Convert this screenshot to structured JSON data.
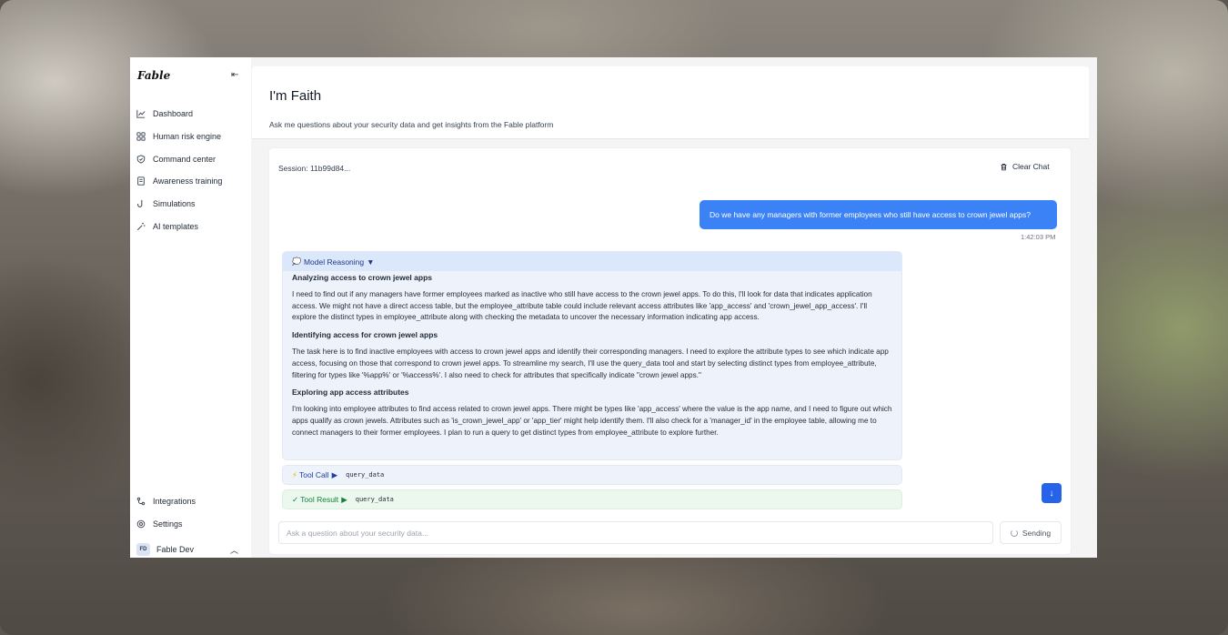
{
  "app": {
    "logo_text": "Fable"
  },
  "sidebar": {
    "items": [
      {
        "label": "Dashboard",
        "icon": "chart-line-icon"
      },
      {
        "label": "Human risk engine",
        "icon": "grid-icon"
      },
      {
        "label": "Command center",
        "icon": "shield-icon"
      },
      {
        "label": "Awareness training",
        "icon": "book-icon"
      },
      {
        "label": "Simulations",
        "icon": "hook-icon"
      },
      {
        "label": "AI templates",
        "icon": "wand-icon"
      }
    ],
    "bottom_items": [
      {
        "label": "Integrations",
        "icon": "integrations-icon"
      },
      {
        "label": "Settings",
        "icon": "settings-icon"
      }
    ],
    "user": {
      "initials": "FD",
      "name": "Fable Dev"
    }
  },
  "header": {
    "title": "I'm Faith",
    "subtitle": "Ask me questions about your security data and get insights from the Fable platform"
  },
  "chat": {
    "session_label": "Session: 11b99d84...",
    "clear_label": "Clear Chat",
    "user_message": "Do we have any managers with former employees who still have access to crown jewel apps?",
    "user_message_time": "1:42:03 PM",
    "reasoning": {
      "header_icon": "💭",
      "header_label": "Model Reasoning",
      "toggle": "▼",
      "sections": [
        {
          "heading": "Analyzing access to crown jewel apps",
          "text": "I need to find out if any managers have former employees marked as inactive who still have access to the crown jewel apps. To do this, I'll look for data that indicates application access. We might not have a direct access table, but the employee_attribute table could include relevant access attributes like 'app_access' and 'crown_jewel_app_access'. I'll explore the distinct types in employee_attribute along with checking the metadata to uncover the necessary information indicating app access."
        },
        {
          "heading": "Identifying access for crown jewel apps",
          "text": "The task here is to find inactive employees with access to crown jewel apps and identify their corresponding managers. I need to explore the attribute types to see which indicate app access, focusing on those that correspond to crown jewel apps. To streamline my search, I'll use the query_data tool and start by selecting distinct types from employee_attribute, filtering for types like '%app%' or '%access%'. I also need to check for attributes that specifically indicate \"crown jewel apps.\""
        },
        {
          "heading": "Exploring app access attributes",
          "text": "I'm looking into employee attributes to find access related to crown jewel apps. There might be types like 'app_access' where the value is the app name, and I need to figure out which apps qualify as crown jewels. Attributes such as 'is_crown_jewel_app' or 'app_tier' might help identify them. I'll also check for a 'manager_id' in the employee table, allowing me to connect managers to their former employees. I plan to run a query to get distinct types from employee_attribute to explore further."
        }
      ]
    },
    "tool_call": {
      "icon": "⚡",
      "label": "Tool Call",
      "toggle": "▶",
      "name": "query_data"
    },
    "tool_result": {
      "icon": "✓",
      "label": "Tool Result",
      "toggle": "▶",
      "name": "query_data"
    },
    "input": {
      "placeholder": "Ask a question about your security data...",
      "value": ""
    },
    "send_label": "Sending"
  },
  "colors": {
    "accent": "#3b82f6",
    "scroll_button": "#2563eb",
    "reasoning_bg": "#eef3fb",
    "tool_result_bg": "#ecf8ee"
  }
}
